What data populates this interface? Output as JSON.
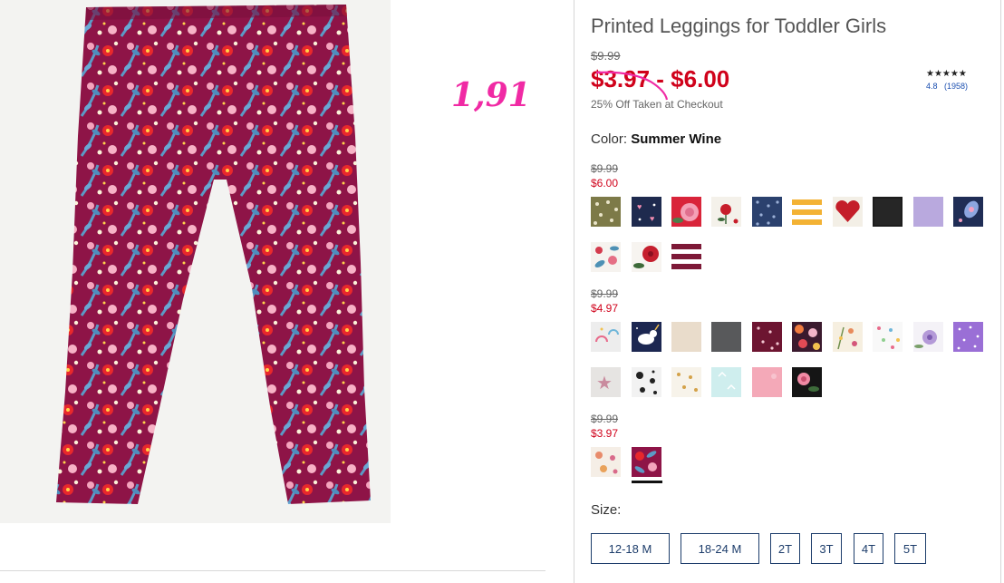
{
  "product": {
    "title": "Printed Leggings for Toddler Girls",
    "original_price": "$9.99",
    "sale_range": "$3.97 - $6.00",
    "promo": "25% Off Taken at Checkout",
    "rating": {
      "stars": "★★★★★",
      "score": "4.8",
      "reviews": "(1958)"
    },
    "color_label": "Color:",
    "color_value": "Summer Wine"
  },
  "annotation": {
    "handwritten_price": "1,91"
  },
  "price_groups": [
    {
      "original": "$9.99",
      "sale": "$6.00"
    },
    {
      "original": "$9.99",
      "sale": "$4.97"
    },
    {
      "original": "$9.99",
      "sale": "$3.97"
    }
  ],
  "swatches": {
    "group1": [
      "olive-dots",
      "navy-hearts",
      "red-rose",
      "white-red-flower",
      "navy-dots",
      "yellow-stripes",
      "red-heart",
      "black",
      "lavender",
      "navy-paisley",
      "white-floral",
      "white-red-floral",
      "maroon-stripes"
    ],
    "group2": [
      "white-rainbow",
      "navy-unicorn",
      "oatmeal",
      "charcoal",
      "maroon-dots",
      "orange-floral",
      "cream-floral",
      "white-multidot",
      "white-lilac-floral",
      "purple-dots",
      "grey-star",
      "black-white-splatter",
      "cream-gold-dots",
      "mint-pattern",
      "pink",
      "black-pink-rose"
    ],
    "group3": [
      "cream-pattern",
      "summer-wine"
    ],
    "selected": "summer-wine"
  },
  "colors": {
    "sale_red": "#d0021b",
    "annotation_pink": "#f02aa4",
    "size_border": "#1d3d6b",
    "legging_wine": "#8e1447"
  },
  "sizes": {
    "label": "Size:",
    "options": [
      "12-18 M",
      "18-24 M",
      "2T",
      "3T",
      "4T",
      "5T"
    ]
  }
}
